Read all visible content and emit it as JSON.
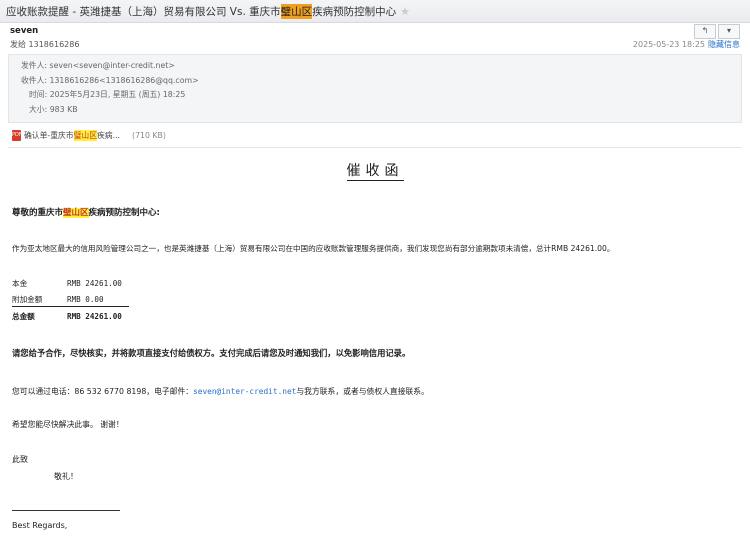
{
  "window": {
    "title_prefix": "应收账款提醒 - 英潍捷基（上海）贸易有限公司 Vs. 重庆市",
    "title_highlight": "璧山区",
    "title_suffix": "疾病预防控制中心"
  },
  "message": {
    "sender_name": "seven",
    "recipient_line": "发给 1318616286",
    "date": "2025-05-23 18:25",
    "detail_link": "隐藏信息"
  },
  "details": {
    "from_label": "发件人:",
    "from_value": "seven<seven@inter-credit.net>",
    "to_label": "收件人:",
    "to_value": "1318616286<1318616286@qq.com>",
    "time_label": "时间:",
    "time_value": "2025年5月23日, 星期五 (周五) 18:25",
    "size_label": "大小:",
    "size_value": "983 KB"
  },
  "attachment": {
    "icon_text": "PDF",
    "name_prefix": "确认单-重庆市",
    "name_highlight": "璧山区",
    "name_suffix": "疾病...",
    "size": "(710 KB)"
  },
  "letter": {
    "title": "催收函",
    "greeting_prefix": "尊敬的重庆市",
    "greeting_highlight": "璧山区",
    "greeting_suffix": "疾病预防控制中心:",
    "intro": "作为亚太地区最大的信用风险管理公司之一，也是英潍捷基（上海）贸易有限公司在中国的应收账款管理服务提供商，我们发现您尚有部分逾期款项未清偿，总计RMB 24261.00。",
    "amounts": [
      {
        "label": "本金",
        "value": "RMB 24261.00"
      },
      {
        "label": "附加金额",
        "value": "RMB 0.00"
      },
      {
        "label": "总金额",
        "value": "RMB 24261.00"
      }
    ],
    "request": "请您给予合作，尽快核实，并将款项直接支付给债权方。支付完成后请您及时通知我们，以免影响信用记录。",
    "contact_prefix": "您可以通过电话：86 532 6770 8198，电子邮件：",
    "contact_email": "seven@inter-credit.net",
    "contact_suffix": "与我方联系，或者与债权人直接联系。",
    "hope": "希望您能尽快解决此事。 谢谢！",
    "closing": "此致",
    "salute": "敬礼！",
    "regards": "Best Regards,"
  }
}
